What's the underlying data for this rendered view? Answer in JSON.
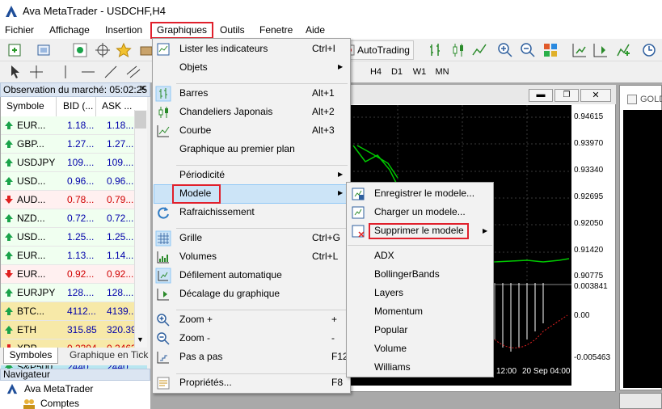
{
  "window": {
    "title": "Ava MetaTrader - USDCHF,H4"
  },
  "menubar": {
    "items": [
      "Fichier",
      "Affichage",
      "Insertion",
      "Graphiques",
      "Outils",
      "Fenetre",
      "Aide"
    ]
  },
  "toolbar": {
    "autotrading": "AutoTrading",
    "timeframes": [
      "H4",
      "D1",
      "W1",
      "MN"
    ]
  },
  "market_watch": {
    "title": "Observation du marché: 05:02:25",
    "columns": [
      "Symbole",
      "BID (...",
      "ASK ..."
    ],
    "rows": [
      {
        "symbol": "EUR...",
        "bid": "1.18...",
        "ask": "1.18...",
        "dir": "up",
        "color": "#0000aa",
        "bg": "#f0fff0"
      },
      {
        "symbol": "GBP...",
        "bid": "1.27...",
        "ask": "1.27...",
        "dir": "up",
        "color": "#0000aa",
        "bg": "#f0fff0"
      },
      {
        "symbol": "USDJPY",
        "bid": "109....",
        "ask": "109....",
        "dir": "up",
        "color": "#0000aa",
        "bg": "#f0fff0"
      },
      {
        "symbol": "USD...",
        "bid": "0.96...",
        "ask": "0.96...",
        "dir": "up",
        "color": "#0000aa",
        "bg": "#f0fff0"
      },
      {
        "symbol": "AUD...",
        "bid": "0.78...",
        "ask": "0.79...",
        "dir": "down",
        "color": "#d00000",
        "bg": "#fff0f0"
      },
      {
        "symbol": "NZD...",
        "bid": "0.72...",
        "ask": "0.72...",
        "dir": "up",
        "color": "#0000aa",
        "bg": "#f0fff0"
      },
      {
        "symbol": "USD...",
        "bid": "1.25...",
        "ask": "1.25...",
        "dir": "up",
        "color": "#0000aa",
        "bg": "#f0fff0"
      },
      {
        "symbol": "EUR...",
        "bid": "1.13...",
        "ask": "1.14...",
        "dir": "up",
        "color": "#0000aa",
        "bg": "#f0fff0"
      },
      {
        "symbol": "EUR...",
        "bid": "0.92...",
        "ask": "0.92...",
        "dir": "down",
        "color": "#d00000",
        "bg": "#fff0f0"
      },
      {
        "symbol": "EURJPY",
        "bid": "128....",
        "ask": "128....",
        "dir": "up",
        "color": "#0000aa",
        "bg": "#f0fff0"
      },
      {
        "symbol": "BTC...",
        "bid": "4112...",
        "ask": "4139...",
        "dir": "up",
        "color": "#0000aa",
        "bg": "#f7e9a8"
      },
      {
        "symbol": "ETH",
        "bid": "315.85",
        "ask": "320.39",
        "dir": "up",
        "color": "#0000aa",
        "bg": "#f7e9a8"
      },
      {
        "symbol": "XRP",
        "bid": "0.2394",
        "ask": "0.2463",
        "dir": "down",
        "color": "#d00000",
        "bg": "#f7e9a8"
      },
      {
        "symbol": "S&P500",
        "bid": "2440...",
        "ask": "2440...",
        "dir": "up",
        "color": "#0000aa",
        "bg": "#b8e6f0"
      }
    ],
    "tabs": [
      "Symboles",
      "Graphique en Tick"
    ]
  },
  "navigator": {
    "title": "Navigateur",
    "root": "Ava MetaTrader",
    "child": "Comptes"
  },
  "chart": {
    "price_labels": [
      "0.94615",
      "0.93970",
      "0.93340",
      "0.92695",
      "0.92050",
      "0.91420",
      "0.90775"
    ],
    "osc_labels": [
      "0.003841",
      "0.00",
      "-0.005463"
    ],
    "time_labels": [
      "12:00",
      "20 Sep 04:00"
    ],
    "gold_tab": "GOLD"
  },
  "graphiques_menu": {
    "items": [
      {
        "label": "Lister les indicateurs",
        "shortcut": "Ctrl+I",
        "icon": "indicator-list-icon"
      },
      {
        "label": "Objets",
        "submenu": true
      },
      {
        "sep": true
      },
      {
        "label": "Barres",
        "shortcut": "Alt+1",
        "icon": "bar-chart-icon"
      },
      {
        "label": "Chandeliers Japonais",
        "shortcut": "Alt+2",
        "icon": "candlestick-icon"
      },
      {
        "label": "Courbe",
        "shortcut": "Alt+3",
        "icon": "line-chart-icon"
      },
      {
        "label": "Graphique  au premier plan"
      },
      {
        "sep": true
      },
      {
        "label": "Périodicité",
        "submenu": true
      },
      {
        "label": "Modele",
        "submenu": true,
        "highlighted": true
      },
      {
        "label": "Rafraichissement",
        "icon": "refresh-icon"
      },
      {
        "sep": true
      },
      {
        "label": "Grille",
        "shortcut": "Ctrl+G",
        "icon": "grid-icon"
      },
      {
        "label": "Volumes",
        "shortcut": "Ctrl+L",
        "icon": "volumes-icon"
      },
      {
        "label": "Défilement automatique",
        "icon": "autoscroll-icon"
      },
      {
        "label": "Décalage du graphique",
        "icon": "chart-shift-icon"
      },
      {
        "sep": true
      },
      {
        "label": "Zoom +",
        "shortcut": "+",
        "icon": "zoom-in-icon"
      },
      {
        "label": "Zoom -",
        "shortcut": "-",
        "icon": "zoom-out-icon"
      },
      {
        "label": "Pas a pas",
        "shortcut": "F12",
        "icon": "step-icon"
      },
      {
        "sep": true
      },
      {
        "label": "Propriétés...",
        "shortcut": "F8",
        "icon": "properties-icon"
      }
    ]
  },
  "modele_submenu": {
    "items": [
      "Enregistrer le modele...",
      "Charger un modele...",
      "Supprimer le modele",
      "ADX",
      "BollingerBands",
      "Layers",
      "Momentum",
      "Popular",
      "Volume",
      "Williams"
    ]
  }
}
